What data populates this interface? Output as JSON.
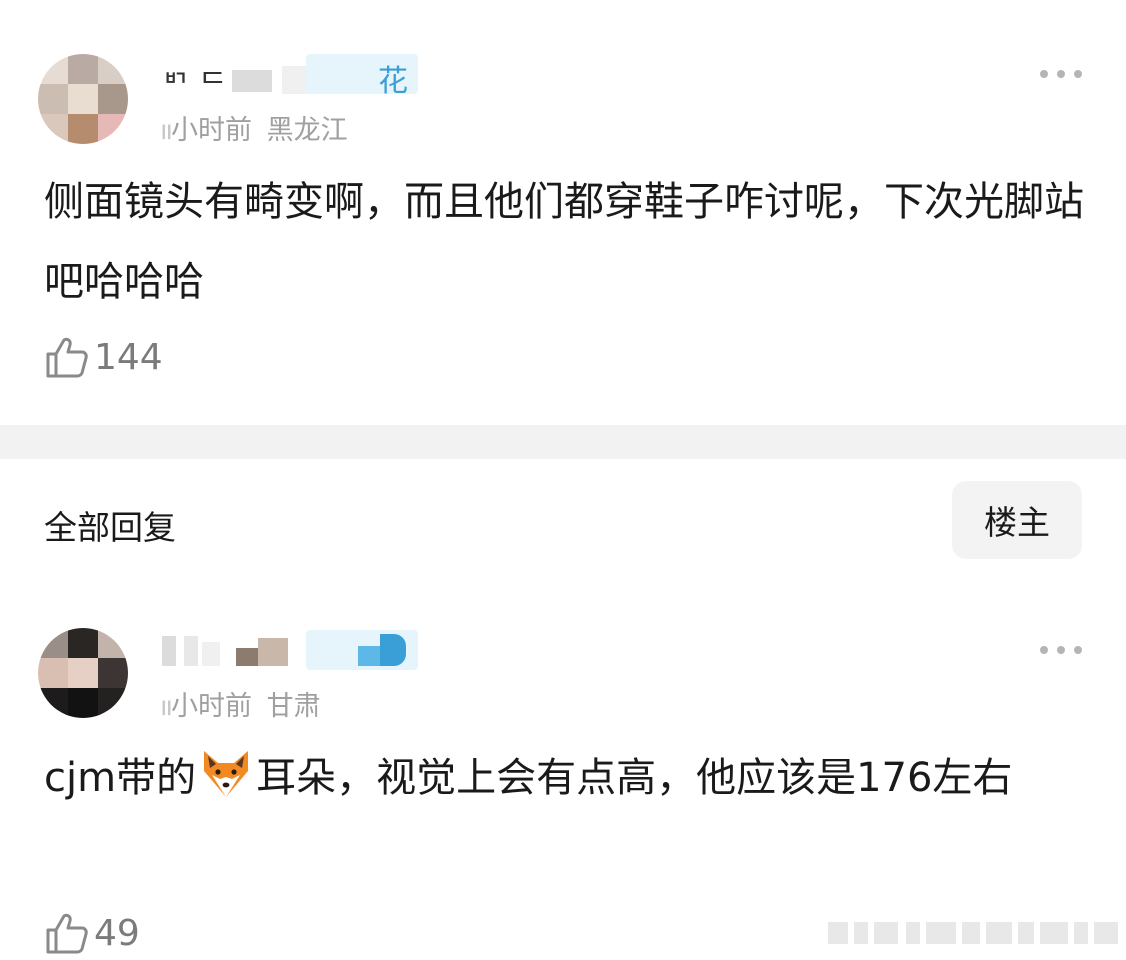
{
  "comments": [
    {
      "username_visible": "ᄞ ᄃ",
      "badge_text": "花",
      "time_prefix": "ıı",
      "time": "小时前",
      "location": "黑龙江",
      "text": "侧面镜头有畸变啊，而且他们都穿鞋子咋讨呢，下次光脚站吧哈哈哈",
      "likes": "144"
    },
    {
      "time_prefix": "ıı",
      "time": "小时前",
      "location": "甘肃",
      "text_before_emoji": "cjm带的",
      "emoji": "fox-face",
      "text_after_emoji": "耳朵，视觉上会有点高，他应该是176左右",
      "likes": "49"
    }
  ],
  "replies": {
    "title": "全部回复",
    "owner_button": "楼主"
  },
  "icons": {
    "like": "thumbs-up-icon",
    "more": "more-dots-icon"
  },
  "colors": {
    "text": "#1a1a1a",
    "meta": "#a0a0a0",
    "badge": "#3a9fd6",
    "separator": "#f2f2f2"
  }
}
